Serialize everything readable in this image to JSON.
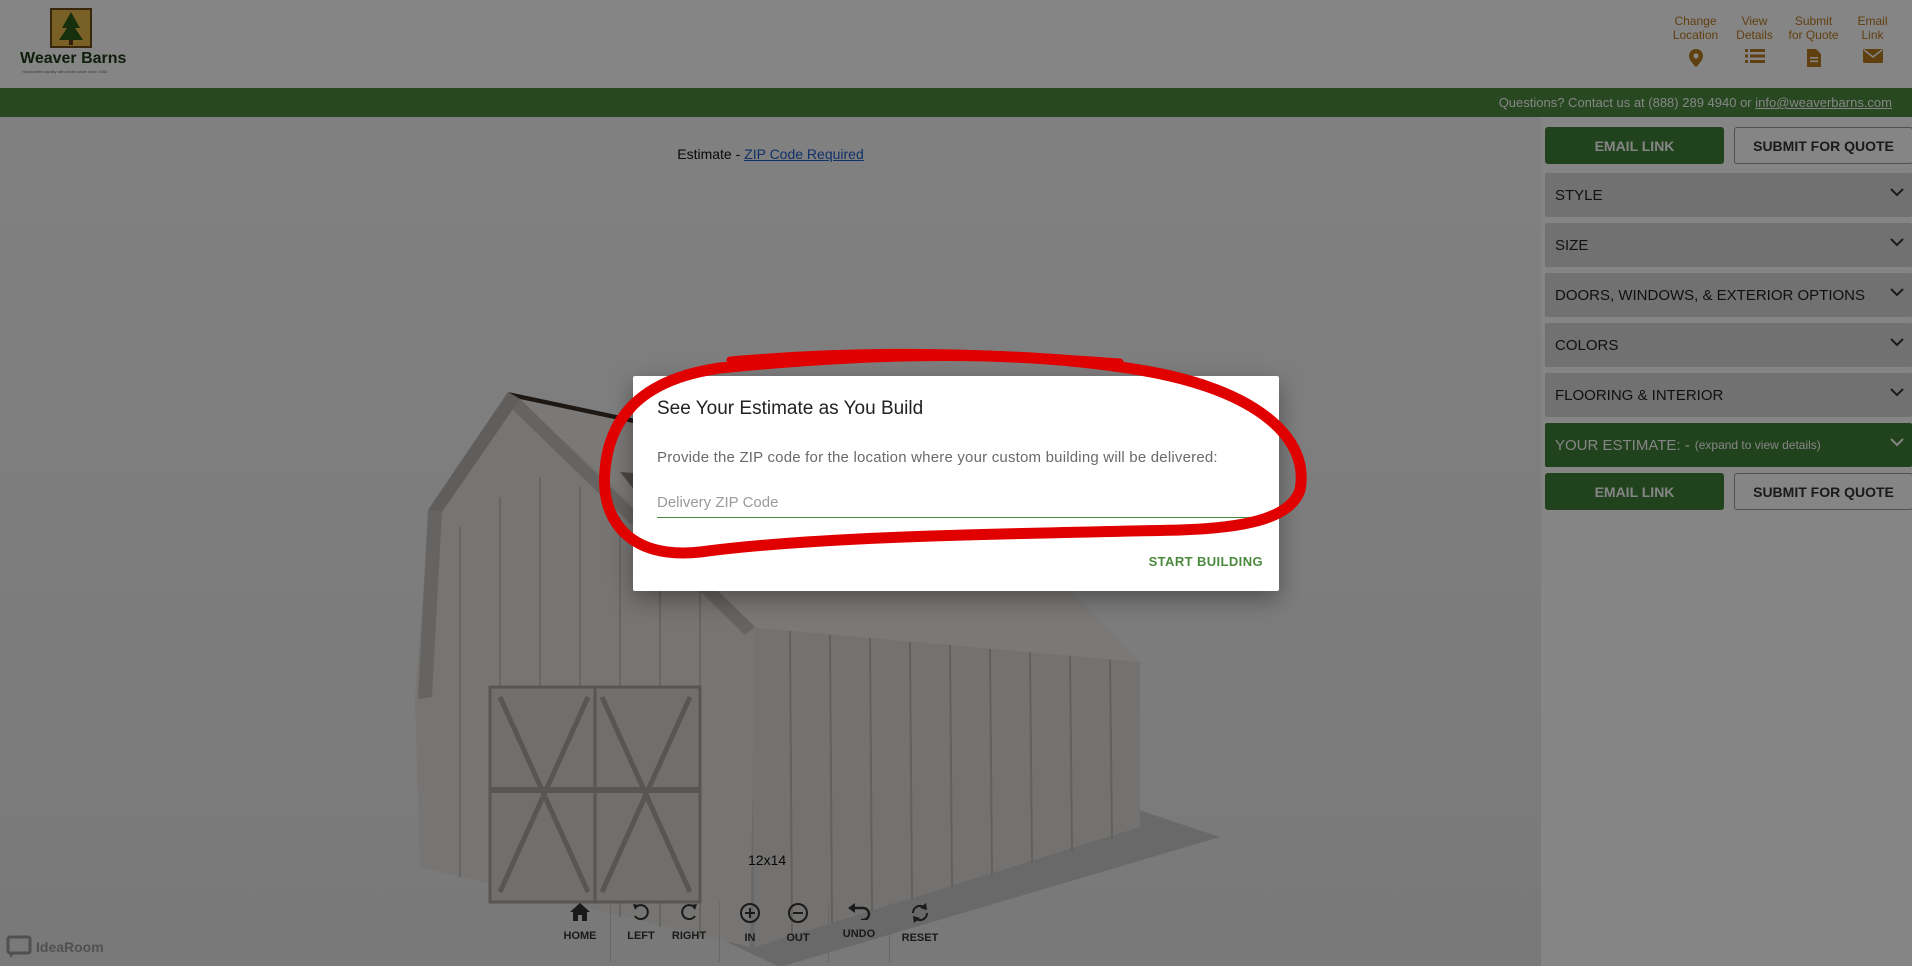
{
  "brand": {
    "name": "Weaver Barns",
    "tagline": "Handcrafted quality with Amish pride since 1983"
  },
  "top_actions": [
    {
      "label_line1": "Change",
      "label_line2": "Location",
      "icon": "location-pin-icon"
    },
    {
      "label_line1": "View",
      "label_line2": "Details",
      "icon": "list-icon"
    },
    {
      "label_line1": "Submit",
      "label_line2": "for Quote",
      "icon": "document-icon"
    },
    {
      "label_line1": "Email",
      "label_line2": "Link",
      "icon": "envelope-icon"
    }
  ],
  "contact_bar": {
    "text": "Questions? Contact us at (888) 289 4940 or ",
    "email": "info@weaverbarns.com"
  },
  "viewer": {
    "estimate_prefix": "Estimate - ",
    "estimate_link": "ZIP Code Required",
    "size_label": "12x14",
    "controls": [
      {
        "label": "HOME",
        "icon": "home-icon"
      },
      {
        "label": "LEFT",
        "icon": "rotate-left-icon"
      },
      {
        "label": "RIGHT",
        "icon": "rotate-right-icon"
      },
      {
        "label": "IN",
        "icon": "zoom-in-icon"
      },
      {
        "label": "OUT",
        "icon": "zoom-out-icon"
      },
      {
        "label": "UNDO",
        "icon": "undo-icon"
      },
      {
        "label": "RESET",
        "icon": "reset-icon"
      }
    ],
    "powered_by": "IdeaRoom"
  },
  "panel": {
    "email_link_label": "EMAIL LINK",
    "submit_quote_label": "SUBMIT FOR QUOTE",
    "sections": [
      "STYLE",
      "SIZE",
      "DOORS, WINDOWS, & EXTERIOR OPTIONS",
      "COLORS",
      "FLOORING & INTERIOR"
    ],
    "estimate_title": "YOUR ESTIMATE: -",
    "estimate_hint": "(expand to view details)"
  },
  "modal": {
    "title": "See Your Estimate as You Build",
    "text": "Provide the ZIP code for the location where your custom building will be delivered:",
    "input_placeholder": "Delivery ZIP Code",
    "input_value": "",
    "start_label": "START BUILDING"
  },
  "colors": {
    "brand_green": "#3f7f36",
    "accent_orange": "#b97c1e",
    "link_blue": "#1d5ec9",
    "annotation_red": "#e00000"
  }
}
